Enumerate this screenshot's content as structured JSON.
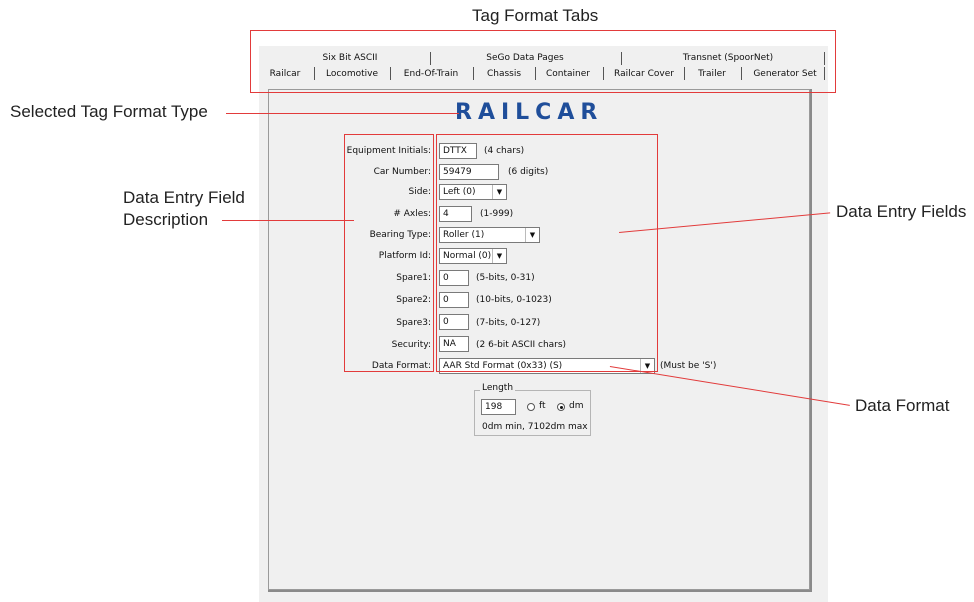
{
  "callouts": {
    "tag_format_tabs": "Tag Format Tabs",
    "selected_type": "Selected Tag Format Type",
    "field_description_line1": "Data Entry Field",
    "field_description_line2": "Description",
    "entry_fields": "Data Entry Fields",
    "data_format": "Data Format"
  },
  "tabs": {
    "row1": [
      "Six Bit ASCII",
      "SeGo Data Pages",
      "Transnet (SpoorNet)"
    ],
    "row2": [
      "Railcar",
      "Locomotive",
      "End-Of-Train",
      "Chassis",
      "Container",
      "Railcar Cover",
      "Trailer",
      "Generator Set"
    ],
    "selected": "Railcar"
  },
  "form": {
    "title": "RAILCAR",
    "equipment_initials": {
      "label": "Equipment Initials:",
      "value": "DTTX",
      "hint": "(4 chars)"
    },
    "car_number": {
      "label": "Car Number:",
      "value": "59479",
      "hint": "(6 digits)"
    },
    "side": {
      "label": "Side:",
      "value": "Left (0)"
    },
    "axles": {
      "label": "# Axles:",
      "value": "4",
      "hint": "(1-999)"
    },
    "bearing_type": {
      "label": "Bearing Type:",
      "value": "Roller (1)"
    },
    "platform_id": {
      "label": "Platform Id:",
      "value": "Normal (0)"
    },
    "spare1": {
      "label": "Spare1:",
      "value": "0",
      "hint": "(5-bits, 0-31)"
    },
    "spare2": {
      "label": "Spare2:",
      "value": "0",
      "hint": "(10-bits, 0-1023)"
    },
    "spare3": {
      "label": "Spare3:",
      "value": "0",
      "hint": "(7-bits, 0-127)"
    },
    "security": {
      "label": "Security:",
      "value": "NA",
      "hint": "(2 6-bit ASCII chars)"
    },
    "data_format": {
      "label": "Data Format:",
      "value": "AAR Std Format (0x33) (S)",
      "hint": "(Must be 'S')"
    }
  },
  "length": {
    "group_label": "Length",
    "value": "198",
    "unit_ft": "ft",
    "unit_dm": "dm",
    "selected_unit": "dm",
    "range": "0dm min, 7102dm max"
  },
  "colors": {
    "callout_red": "#e23b3b",
    "title_blue": "#1f4e9a"
  }
}
